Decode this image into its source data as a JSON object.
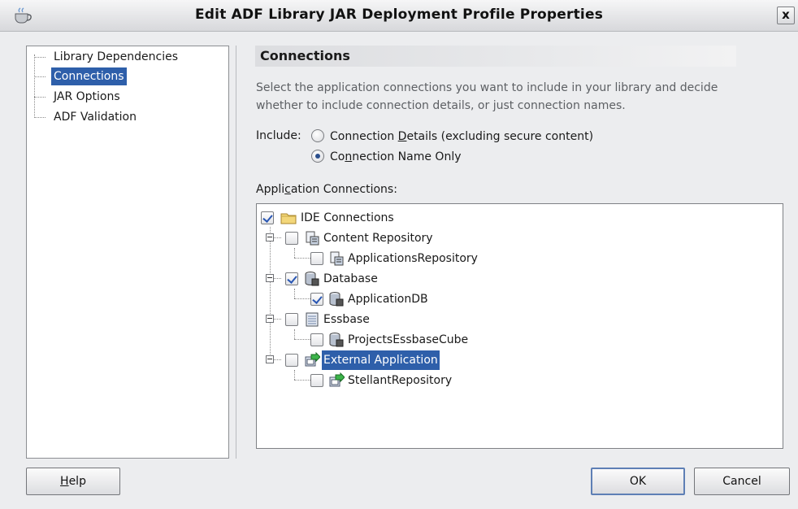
{
  "window": {
    "title": "Edit ADF Library JAR Deployment Profile Properties",
    "close_label": "x",
    "app_icon": "coffee-cup-icon"
  },
  "nav": {
    "items": [
      {
        "label": "Library Dependencies",
        "selected": false
      },
      {
        "label": "Connections",
        "selected": true
      },
      {
        "label": "JAR Options",
        "selected": false
      },
      {
        "label": "ADF Validation",
        "selected": false
      }
    ]
  },
  "panel": {
    "title": "Connections",
    "description_line1": "Select the application connections you want to include in your library and decide",
    "description_line2": "whether to include connection details, or just connection names.",
    "include_label": "Include:",
    "options": [
      {
        "pre": "Connection ",
        "mnemonic": "D",
        "post": "etails (excluding secure content)",
        "checked": false
      },
      {
        "pre": "Co",
        "mnemonic": "n",
        "post": "nection Name Only",
        "checked": true
      }
    ],
    "app_connections_label_pre": "Appli",
    "app_connections_label_mnemonic": "c",
    "app_connections_label_post": "ation Connections:"
  },
  "tree": {
    "root": {
      "label": "IDE Connections",
      "checked": true,
      "icon": "folder-icon"
    },
    "nodes": [
      {
        "label": "Content Repository",
        "checked": false,
        "icon": "content-repository-icon",
        "children": [
          {
            "label": "ApplicationsRepository",
            "checked": false
          }
        ]
      },
      {
        "label": "Database",
        "checked": true,
        "icon": "database-icon",
        "children": [
          {
            "label": "ApplicationDB",
            "checked": true
          }
        ]
      },
      {
        "label": "Essbase",
        "checked": false,
        "icon": "essbase-icon",
        "children": [
          {
            "label": "ProjectsEssbaseCube",
            "checked": false
          }
        ]
      },
      {
        "label": "External Application",
        "checked": false,
        "selected": true,
        "icon": "external-application-icon",
        "children": [
          {
            "label": "StellantRepository",
            "checked": false
          }
        ]
      }
    ]
  },
  "buttons": {
    "help_mnemonic": "H",
    "help_rest": "elp",
    "ok": "OK",
    "cancel": "Cancel"
  },
  "colors": {
    "selection": "#2e5faa",
    "description_text": "#5d6064"
  }
}
